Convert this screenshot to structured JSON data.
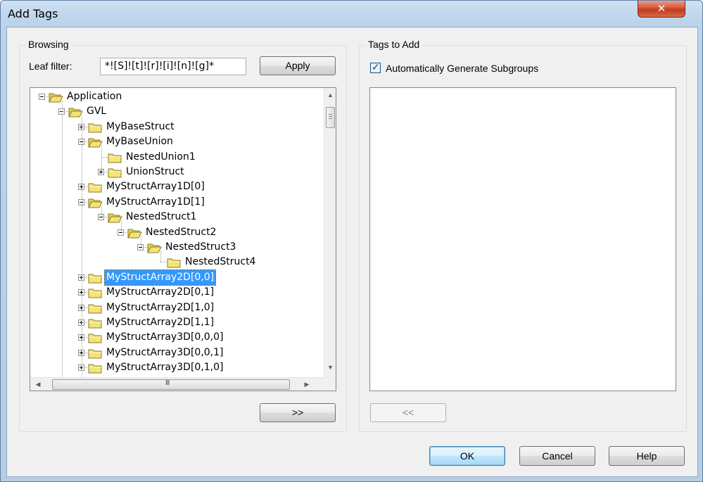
{
  "window": {
    "title": "Add Tags",
    "close_glyph": "✕"
  },
  "browsing": {
    "group_label": "Browsing",
    "leaf_filter_label": "Leaf filter:",
    "leaf_filter_value": "*![S]![t]![r]![i]![n]![g]*",
    "apply_label": "Apply",
    "add_label": ">>",
    "tree": {
      "nodes": [
        {
          "label": "Application",
          "expander": "minus",
          "depth": 0
        },
        {
          "label": "GVL",
          "expander": "minus",
          "depth": 1
        },
        {
          "label": "MyBaseStruct",
          "expander": "plus",
          "depth": 2
        },
        {
          "label": "MyBaseUnion",
          "expander": "minus",
          "depth": 2
        },
        {
          "label": "NestedUnion1",
          "expander": "none",
          "depth": 3
        },
        {
          "label": "UnionStruct",
          "expander": "plus",
          "depth": 3
        },
        {
          "label": "MyStructArray1D[0]",
          "expander": "plus",
          "depth": 2
        },
        {
          "label": "MyStructArray1D[1]",
          "expander": "minus",
          "depth": 2
        },
        {
          "label": "NestedStruct1",
          "expander": "minus",
          "depth": 3
        },
        {
          "label": "NestedStruct2",
          "expander": "minus",
          "depth": 4
        },
        {
          "label": "NestedStruct3",
          "expander": "minus",
          "depth": 5
        },
        {
          "label": "NestedStruct4",
          "expander": "none",
          "depth": 6
        },
        {
          "label": "MyStructArray2D[0,0]",
          "expander": "plus",
          "depth": 2,
          "selected": true
        },
        {
          "label": "MyStructArray2D[0,1]",
          "expander": "plus",
          "depth": 2
        },
        {
          "label": "MyStructArray2D[1,0]",
          "expander": "plus",
          "depth": 2
        },
        {
          "label": "MyStructArray2D[1,1]",
          "expander": "plus",
          "depth": 2
        },
        {
          "label": "MyStructArray3D[0,0,0]",
          "expander": "plus",
          "depth": 2
        },
        {
          "label": "MyStructArray3D[0,0,1]",
          "expander": "plus",
          "depth": 2
        },
        {
          "label": "MyStructArray3D[0,1,0]",
          "expander": "plus",
          "depth": 2
        }
      ]
    },
    "scroll": {
      "up_arrow": "▲",
      "down_arrow": "▼",
      "left_arrow": "◀",
      "right_arrow": "▶",
      "h_thumb_grip": "III"
    }
  },
  "tags_to_add": {
    "group_label": "Tags to Add",
    "auto_subgroups_label": "Automatically Generate Subgroups",
    "auto_subgroups_checked": true,
    "checkmark": "✓",
    "remove_label": "<<"
  },
  "footer": {
    "ok_label": "OK",
    "cancel_label": "Cancel",
    "help_label": "Help"
  },
  "colors": {
    "selection": "#3399ff",
    "folder": "#f4e37a",
    "title_close": "#c23a1d"
  }
}
